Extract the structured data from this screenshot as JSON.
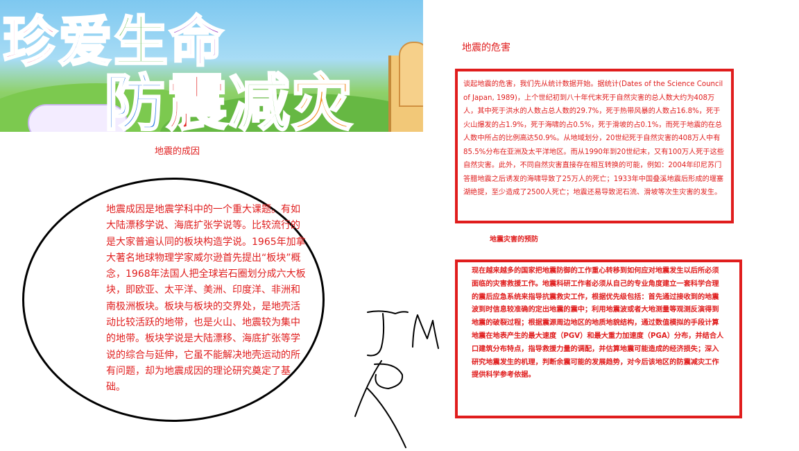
{
  "banner": {
    "title_line1": [
      "珍",
      "爱",
      "生",
      "命"
    ],
    "title_line2": [
      "防",
      "震",
      "减",
      "灾"
    ]
  },
  "left": {
    "heading": "地震的成因",
    "body": "地震成因是地震学科中的一个重大课题。有如大陆漂移学说、海底扩张学说等。比较流行的是大家普遍认同的板块构造学说。1965年加拿大著名地球物理学家威尔逊首先提出“板块”概念，1968年法国人把全球岩石圈划分成六大板块，即欧亚、太平洋、美洲、印度洋、非洲和南极洲板块。板块与板块的交界处，是地壳活动比较活跃的地带，也是火山、地震较为集中的地带。板块学说是大陆漂移、海底扩张等学说的综合与延伸，它虽不能解决地壳运动的所有问题，却为地震成因的理论研究奠定了基础。"
  },
  "right_top": {
    "heading": "地震的危害",
    "body": "谈起地震的危害，我们先从统计数据开始。据统计(Dates of the Science Council of Japan, 1989)，上个世纪初到八十年代末死于自然灾害的总人数大约为408万人，其中死于洪水的人数占总人数的29.7%，死于热带风暴的人数占16.8%，死于火山爆发的占1.9%，死于海啸的占0.5%，死于滑坡的占0.1%，而死于地震的在总人数中所占的比例高达50.9%。从地域划分，20世纪死于自然灾害的408万人中有85.5%分布在亚洲及太平洋地区。而从1990年到20世纪末，又有100万人死于这些自然灾害。此外，不同自然灾害直接存在相互转换的可能，例如：2004年印尼苏门答腊地震之后诱发的海啸导致了25万人的死亡；1933年中国叠溪地震后形成的堰塞湖绝提，至少造成了2500人死亡；地震还易导致泥石流、滑坡等次生灾害的发生。"
  },
  "right_bottom": {
    "heading": "地震灾害的预防",
    "body": "现在越来越多的国家把地震防御的工作重心转移到如何应对地震发生以后所必须面临的灾害救援工作。地震科研工作者必须从自己的专业角度建立一套科学合理的震后应急系统来指导抗震救灾工作，根据优先级包括：首先通过接收到的地震波到时信息较准确的定出地震的震中；利用地震波或者大地测量等观测反演得到地震的破裂过程；根据震源周边地区的地质地貌结构，通过数值模拟的手段计算地震在地表产生的最大速度（PGV）和最大重力加速度（PGA）分布，并结合人口建筑分布特点，指导救援力量的调配，并估算地震可能造成的经济损失；深入研究地震发生的机理，判断余震可能的发展趋势，对今后该地区的防震减灾工作提供科学参考依据。"
  },
  "colors": {
    "text_red": "#e01d1d",
    "border_red": "#e01d1d",
    "ellipse_black": "#000000"
  }
}
